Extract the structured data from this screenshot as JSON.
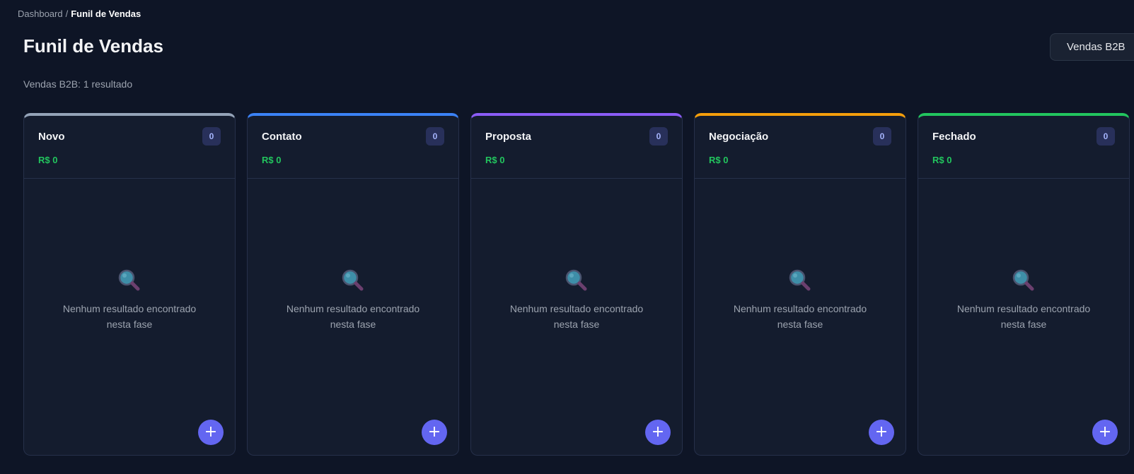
{
  "breadcrumb": {
    "parent": "Dashboard",
    "separator": "/",
    "current": "Funil de Vendas"
  },
  "header": {
    "title": "Funil de Vendas",
    "filter_button_label": "Vendas B2B"
  },
  "summary": "Vendas B2B: 1 resultado",
  "columns": [
    {
      "title": "Novo",
      "count": "0",
      "total": "R$ 0",
      "empty_text": "Nenhum resultado encontrado nesta fase",
      "add_label": "+",
      "accent": "#94a3b8"
    },
    {
      "title": "Contato",
      "count": "0",
      "total": "R$ 0",
      "empty_text": "Nenhum resultado encontrado nesta fase",
      "add_label": "+",
      "accent": "#3b82f6"
    },
    {
      "title": "Proposta",
      "count": "0",
      "total": "R$ 0",
      "empty_text": "Nenhum resultado encontrado nesta fase",
      "add_label": "+",
      "accent": "#8b5cf6"
    },
    {
      "title": "Negociação",
      "count": "0",
      "total": "R$ 0",
      "empty_text": "Nenhum resultado encontrado nesta fase",
      "add_label": "+",
      "accent": "#f59e0b"
    },
    {
      "title": "Fechado",
      "count": "0",
      "total": "R$ 0",
      "empty_text": "Nenhum resultado encontrado nesta fase",
      "add_label": "+",
      "accent": "#22c55e"
    }
  ],
  "colors": {
    "background": "#0e1526",
    "card": "#141c2e",
    "total_green": "#22c55e",
    "add_button": "#6366f1",
    "count_badge": "#28305a"
  },
  "icons": {
    "empty_state": "search-icon",
    "add": "plus-icon"
  }
}
